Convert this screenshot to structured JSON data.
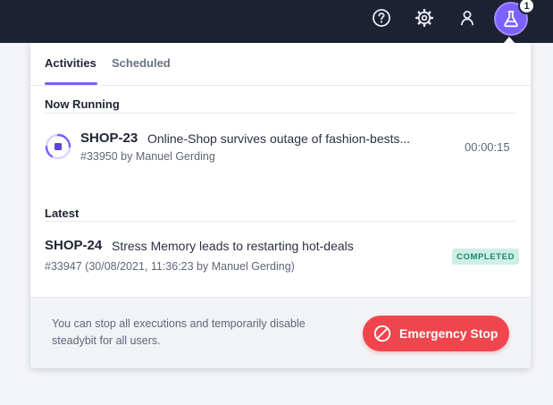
{
  "topbar": {
    "icons": [
      "help-icon",
      "gear-icon",
      "user-icon",
      "flask-icon"
    ],
    "notification_count": "1",
    "accent": "#7b61ff"
  },
  "tabs": [
    {
      "label": "Activities",
      "active": true
    },
    {
      "label": "Scheduled",
      "active": false
    }
  ],
  "now_running": {
    "title": "Now Running",
    "items": [
      {
        "key": "SHOP-23",
        "name": "Online-Shop survives outage of fashion-bests...",
        "meta": "#33950 by Manuel Gerding",
        "elapsed": "00:00:15"
      }
    ]
  },
  "latest": {
    "title": "Latest",
    "items": [
      {
        "key": "SHOP-24",
        "name": "Stress Memory leads to restarting hot-deals",
        "meta": "#33947 (30/08/2021, 11:36:23 by Manuel Gerding)",
        "status": "COMPLETED"
      }
    ]
  },
  "footer": {
    "text": "You can stop all executions and temporarily disable steadybit for all users.",
    "button_label": "Emergency Stop",
    "button_color": "#f0454c"
  }
}
